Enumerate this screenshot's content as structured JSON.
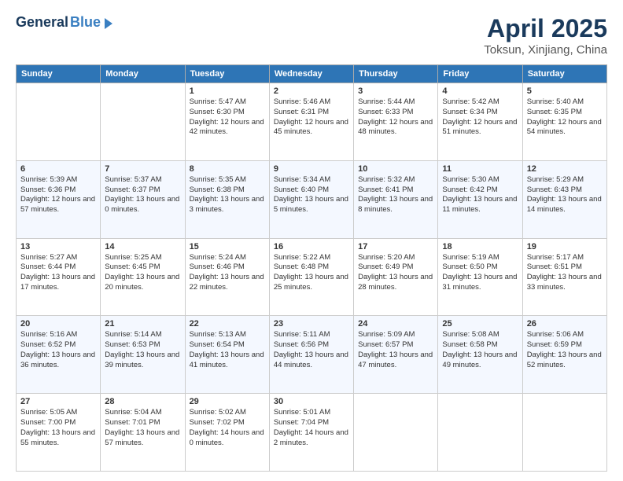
{
  "header": {
    "logo_general": "General",
    "logo_blue": "Blue",
    "title": "April 2025",
    "subtitle": "Toksun, Xinjiang, China"
  },
  "columns": [
    "Sunday",
    "Monday",
    "Tuesday",
    "Wednesday",
    "Thursday",
    "Friday",
    "Saturday"
  ],
  "rows": [
    [
      {
        "day": "",
        "text": ""
      },
      {
        "day": "",
        "text": ""
      },
      {
        "day": "1",
        "text": "Sunrise: 5:47 AM\nSunset: 6:30 PM\nDaylight: 12 hours and 42 minutes."
      },
      {
        "day": "2",
        "text": "Sunrise: 5:46 AM\nSunset: 6:31 PM\nDaylight: 12 hours and 45 minutes."
      },
      {
        "day": "3",
        "text": "Sunrise: 5:44 AM\nSunset: 6:33 PM\nDaylight: 12 hours and 48 minutes."
      },
      {
        "day": "4",
        "text": "Sunrise: 5:42 AM\nSunset: 6:34 PM\nDaylight: 12 hours and 51 minutes."
      },
      {
        "day": "5",
        "text": "Sunrise: 5:40 AM\nSunset: 6:35 PM\nDaylight: 12 hours and 54 minutes."
      }
    ],
    [
      {
        "day": "6",
        "text": "Sunrise: 5:39 AM\nSunset: 6:36 PM\nDaylight: 12 hours and 57 minutes."
      },
      {
        "day": "7",
        "text": "Sunrise: 5:37 AM\nSunset: 6:37 PM\nDaylight: 13 hours and 0 minutes."
      },
      {
        "day": "8",
        "text": "Sunrise: 5:35 AM\nSunset: 6:38 PM\nDaylight: 13 hours and 3 minutes."
      },
      {
        "day": "9",
        "text": "Sunrise: 5:34 AM\nSunset: 6:40 PM\nDaylight: 13 hours and 5 minutes."
      },
      {
        "day": "10",
        "text": "Sunrise: 5:32 AM\nSunset: 6:41 PM\nDaylight: 13 hours and 8 minutes."
      },
      {
        "day": "11",
        "text": "Sunrise: 5:30 AM\nSunset: 6:42 PM\nDaylight: 13 hours and 11 minutes."
      },
      {
        "day": "12",
        "text": "Sunrise: 5:29 AM\nSunset: 6:43 PM\nDaylight: 13 hours and 14 minutes."
      }
    ],
    [
      {
        "day": "13",
        "text": "Sunrise: 5:27 AM\nSunset: 6:44 PM\nDaylight: 13 hours and 17 minutes."
      },
      {
        "day": "14",
        "text": "Sunrise: 5:25 AM\nSunset: 6:45 PM\nDaylight: 13 hours and 20 minutes."
      },
      {
        "day": "15",
        "text": "Sunrise: 5:24 AM\nSunset: 6:46 PM\nDaylight: 13 hours and 22 minutes."
      },
      {
        "day": "16",
        "text": "Sunrise: 5:22 AM\nSunset: 6:48 PM\nDaylight: 13 hours and 25 minutes."
      },
      {
        "day": "17",
        "text": "Sunrise: 5:20 AM\nSunset: 6:49 PM\nDaylight: 13 hours and 28 minutes."
      },
      {
        "day": "18",
        "text": "Sunrise: 5:19 AM\nSunset: 6:50 PM\nDaylight: 13 hours and 31 minutes."
      },
      {
        "day": "19",
        "text": "Sunrise: 5:17 AM\nSunset: 6:51 PM\nDaylight: 13 hours and 33 minutes."
      }
    ],
    [
      {
        "day": "20",
        "text": "Sunrise: 5:16 AM\nSunset: 6:52 PM\nDaylight: 13 hours and 36 minutes."
      },
      {
        "day": "21",
        "text": "Sunrise: 5:14 AM\nSunset: 6:53 PM\nDaylight: 13 hours and 39 minutes."
      },
      {
        "day": "22",
        "text": "Sunrise: 5:13 AM\nSunset: 6:54 PM\nDaylight: 13 hours and 41 minutes."
      },
      {
        "day": "23",
        "text": "Sunrise: 5:11 AM\nSunset: 6:56 PM\nDaylight: 13 hours and 44 minutes."
      },
      {
        "day": "24",
        "text": "Sunrise: 5:09 AM\nSunset: 6:57 PM\nDaylight: 13 hours and 47 minutes."
      },
      {
        "day": "25",
        "text": "Sunrise: 5:08 AM\nSunset: 6:58 PM\nDaylight: 13 hours and 49 minutes."
      },
      {
        "day": "26",
        "text": "Sunrise: 5:06 AM\nSunset: 6:59 PM\nDaylight: 13 hours and 52 minutes."
      }
    ],
    [
      {
        "day": "27",
        "text": "Sunrise: 5:05 AM\nSunset: 7:00 PM\nDaylight: 13 hours and 55 minutes."
      },
      {
        "day": "28",
        "text": "Sunrise: 5:04 AM\nSunset: 7:01 PM\nDaylight: 13 hours and 57 minutes."
      },
      {
        "day": "29",
        "text": "Sunrise: 5:02 AM\nSunset: 7:02 PM\nDaylight: 14 hours and 0 minutes."
      },
      {
        "day": "30",
        "text": "Sunrise: 5:01 AM\nSunset: 7:04 PM\nDaylight: 14 hours and 2 minutes."
      },
      {
        "day": "",
        "text": ""
      },
      {
        "day": "",
        "text": ""
      },
      {
        "day": "",
        "text": ""
      }
    ]
  ]
}
